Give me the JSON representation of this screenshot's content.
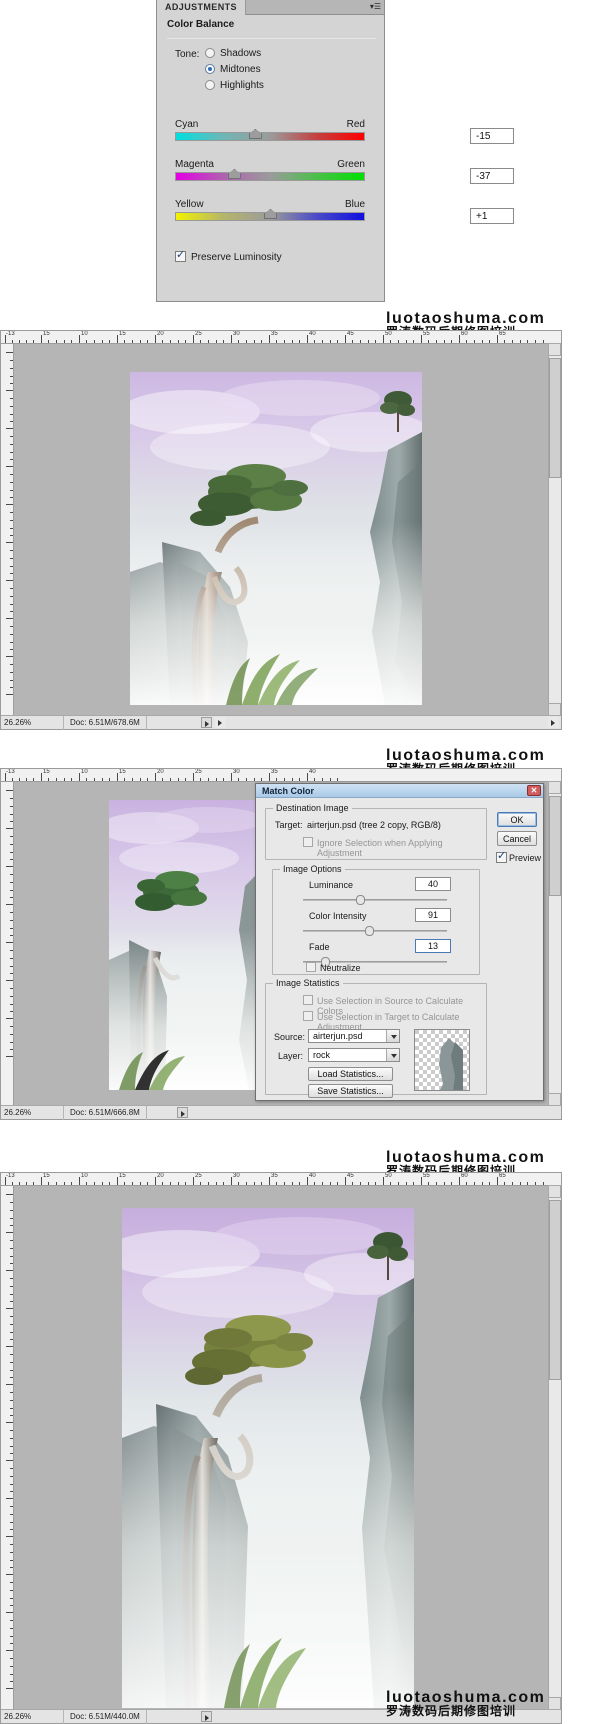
{
  "watermark": {
    "en": "luotaoshuma.com",
    "zh": "罗涛数码后期修图培训"
  },
  "adjustments_panel": {
    "tab_label": "ADJUSTMENTS",
    "panel_menu_icon": "panel-menu-icon",
    "title": "Color Balance",
    "tone_label": "Tone:",
    "tone_options": [
      {
        "label": "Shadows",
        "selected": false
      },
      {
        "label": "Midtones",
        "selected": true
      },
      {
        "label": "Highlights",
        "selected": false
      }
    ],
    "sliders": [
      {
        "left_label": "Cyan",
        "right_label": "Red",
        "value": "-15",
        "thumb_pct": 42
      },
      {
        "left_label": "Magenta",
        "right_label": "Green",
        "value": "-37",
        "thumb_pct": 31
      },
      {
        "left_label": "Yellow",
        "right_label": "Blue",
        "value": "+1",
        "thumb_pct": 50
      }
    ],
    "preserve_luminosity": {
      "label": "Preserve Luminosity",
      "checked": true
    }
  },
  "document_windows": [
    {
      "zoom": "26.26%",
      "doc_info": "Doc: 6.51M/678.6M",
      "ruler_units": [
        "-13",
        "15",
        "10",
        "15",
        "20",
        "25",
        "30",
        "35",
        "40",
        "45",
        "50",
        "55",
        "60",
        "65"
      ]
    },
    {
      "zoom": "26.26%",
      "doc_info": "Doc: 6.51M/666.8M"
    },
    {
      "zoom": "26.26%",
      "doc_info": "Doc: 6.51M/440.0M"
    }
  ],
  "ruler_top_labels": [
    "15",
    "10",
    "15",
    "20",
    "25",
    "30",
    "35",
    "40",
    "45",
    "50",
    "55",
    "60",
    "65"
  ],
  "match_color_dialog": {
    "title": "Match Color",
    "close_icon": "close-icon",
    "destination_image": {
      "legend": "Destination Image",
      "target_label": "Target:",
      "target_value": "airterjun.psd (tree 2 copy, RGB/8)",
      "ignore_selection": {
        "label": "Ignore Selection when Applying Adjustment",
        "checked": false,
        "disabled": true
      }
    },
    "image_options": {
      "legend": "Image Options",
      "fields": [
        {
          "label": "Luminance",
          "value": "40",
          "thumb_pct": 40,
          "focused": false
        },
        {
          "label": "Color Intensity",
          "value": "91",
          "thumb_pct": 45,
          "focused": false
        },
        {
          "label": "Fade",
          "value": "13",
          "thumb_pct": 13,
          "focused": true
        }
      ],
      "neutralize": {
        "label": "Neutralize",
        "checked": false
      }
    },
    "image_statistics": {
      "legend": "Image Statistics",
      "use_selection_source": {
        "label": "Use Selection in Source to Calculate Colors",
        "checked": false,
        "disabled": true
      },
      "use_selection_target": {
        "label": "Use Selection in Target to Calculate Adjustment",
        "checked": false,
        "disabled": true
      },
      "source_label": "Source:",
      "source_value": "airterjun.psd",
      "layer_label": "Layer:",
      "layer_value": "rock",
      "load_statistics": "Load Statistics...",
      "save_statistics": "Save Statistics..."
    },
    "buttons": {
      "ok": "OK",
      "cancel": "Cancel"
    },
    "preview": {
      "label": "Preview",
      "checked": true
    }
  }
}
